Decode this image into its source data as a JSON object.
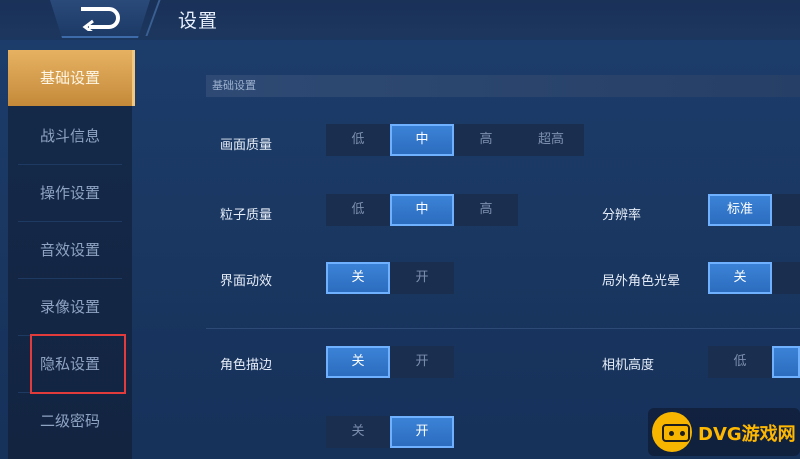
{
  "header": {
    "title": "设置"
  },
  "sidebar": {
    "items": [
      {
        "label": "基础设置"
      },
      {
        "label": "战斗信息"
      },
      {
        "label": "操作设置"
      },
      {
        "label": "音效设置"
      },
      {
        "label": "录像设置"
      },
      {
        "label": "隐私设置"
      },
      {
        "label": "二级密码"
      }
    ],
    "active_index": 0,
    "highlighted_index": 5
  },
  "section": {
    "title": "基础设置"
  },
  "settings": {
    "picture_quality": {
      "label": "画面质量",
      "options": [
        "低",
        "中",
        "高",
        "超高"
      ],
      "selected": "中"
    },
    "particle_quality": {
      "label": "粒子质量",
      "options": [
        "低",
        "中",
        "高"
      ],
      "selected": "中"
    },
    "resolution": {
      "label": "分辨率",
      "options": [
        "标准"
      ],
      "selected": "标准"
    },
    "ui_animation": {
      "label": "界面动效",
      "options": [
        "关",
        "开"
      ],
      "selected": "关"
    },
    "outfield_halo": {
      "label": "局外角色光晕",
      "options": [
        "关"
      ],
      "selected": "关"
    },
    "char_outline": {
      "label": "角色描边",
      "options": [
        "关",
        "开"
      ],
      "selected": "关"
    },
    "camera_height": {
      "label": "相机高度",
      "options": [
        "低"
      ],
      "selected": ""
    },
    "row6_left": {
      "options": [
        "关",
        "开"
      ],
      "selected": "开"
    }
  },
  "watermark": {
    "text": "DVG游戏网"
  },
  "colors": {
    "accent_gold": "#e6b262",
    "selected_blue": "#3c84d8",
    "highlight_red": "#e23b3b"
  }
}
